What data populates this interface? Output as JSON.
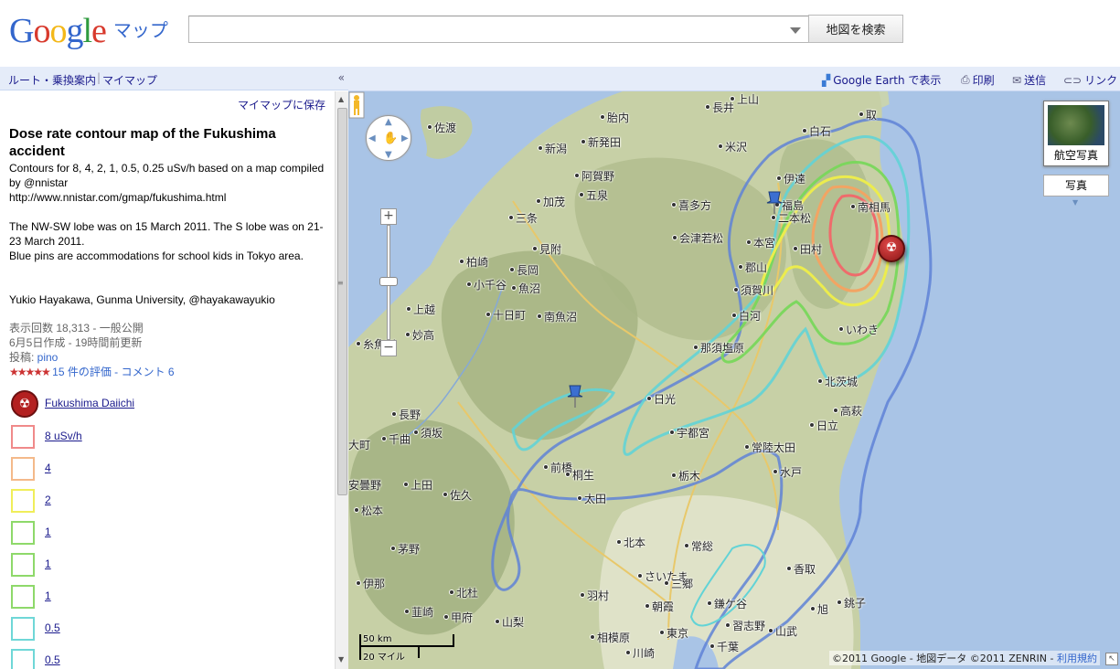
{
  "header": {
    "logo_text": "Google",
    "product_name": "マップ",
    "search": {
      "value": "",
      "placeholder": ""
    },
    "search_button_label": "地図を検索"
  },
  "left_bar": {
    "links": [
      "ルート・乗換案内",
      "マイマップ"
    ],
    "collapse_label": "«"
  },
  "panel": {
    "save_link": "マイマップに保存",
    "title": "Dose rate contour map of the Fukushima accident",
    "description_1": "Contours for 8, 4, 2, 1, 0.5, 0.25 uSv/h based on a map compiled by @nnistar",
    "description_url": "http://www.nnistar.com/gmap/fukushima.html",
    "description_2": "The NW-SW lobe was on 15 March 2011. The S lobe was on 21-23 March 2011.",
    "description_3": "Blue pins are accommodations for school kids in Tokyo area.",
    "description_4": "Yukio Hayakawa, Gunma University, @hayakawayukio",
    "views": "表示回数 18,313 - 一般公開",
    "created": "6月5日作成 - 19時間前更新",
    "author_prefix": "投稿: ",
    "author": "pino",
    "stars": "★★★★★",
    "ratings": "15 件の評価",
    "separator": " - ",
    "comments": "コメント 6",
    "legend": [
      {
        "label": "Fukushima Daiichi",
        "type": "marker",
        "color": "#b32020"
      },
      {
        "label": "8 uSv/h",
        "type": "box",
        "color": "#f08a8a"
      },
      {
        "label": "4",
        "type": "box",
        "color": "#f4b98a"
      },
      {
        "label": "2",
        "type": "box",
        "color": "#f0ee5a"
      },
      {
        "label": "1",
        "type": "box",
        "color": "#8ed96a"
      },
      {
        "label": "1",
        "type": "box",
        "color": "#8ed96a"
      },
      {
        "label": "1",
        "type": "box",
        "color": "#8ed96a"
      },
      {
        "label": "0.5",
        "type": "box",
        "color": "#6fd7d7"
      },
      {
        "label": "0.5",
        "type": "box",
        "color": "#6fd7d7"
      }
    ]
  },
  "toolbar": {
    "earth": "Google Earth で表示",
    "print": "印刷",
    "send": "送信",
    "link": "リンク"
  },
  "map": {
    "sat_button": "航空写真",
    "photo_button": "写真",
    "scale_km": "50 km",
    "scale_mi": "20 マイル",
    "copyright": "©2011 Google - 地図データ ©2011 ZENRIN - ",
    "terms": "利用規約",
    "cities": [
      "佐渡",
      "胎内",
      "新潟",
      "新発田",
      "阿賀野",
      "加茂",
      "五泉",
      "三条",
      "見附",
      "長岡",
      "柏崎",
      "小千谷",
      "魚沼",
      "十日町",
      "南魚沼",
      "上越",
      "妙高",
      "糸魚川",
      "長井",
      "上山",
      "白石",
      "取",
      "米沢",
      "喜多方",
      "会津若松",
      "伊達",
      "福島",
      "二本松",
      "南相馬",
      "本宮",
      "田村",
      "郡山",
      "須賀川",
      "いわき",
      "白河",
      "那須塩原",
      "日光",
      "北茨城",
      "高萩",
      "宇都宮",
      "日立",
      "常陸太田",
      "水戸",
      "前橋",
      "桐生",
      "太田",
      "栃木",
      "長野",
      "千曲",
      "須坂",
      "大町",
      "上田",
      "佐久",
      "安曇野",
      "松本",
      "茅野",
      "伊那",
      "北杜",
      "甲府",
      "韮崎",
      "山梨",
      "羽村",
      "さいたま",
      "朝霞",
      "東京",
      "三郷",
      "相模原",
      "川崎",
      "常総",
      "北本",
      "香取",
      "旭",
      "銚子",
      "鎌ケ谷",
      "習志野",
      "千葉",
      "山武"
    ]
  }
}
